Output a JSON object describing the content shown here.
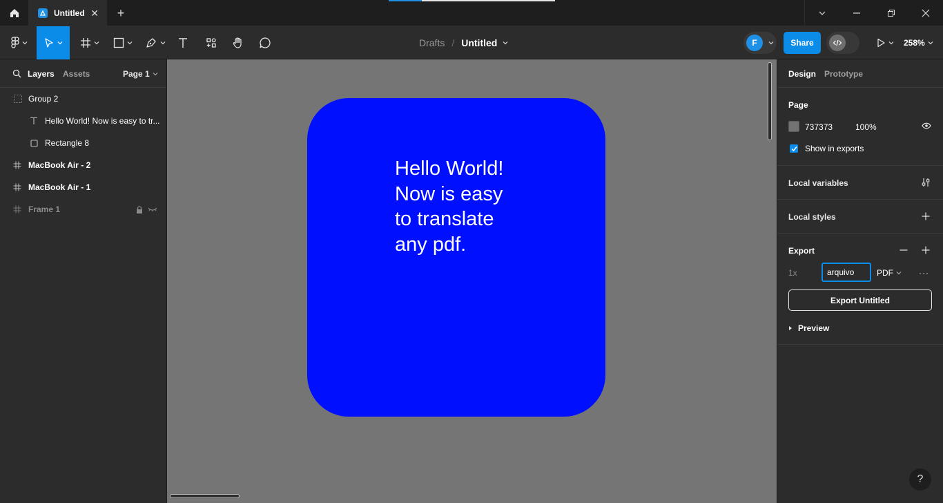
{
  "titlebar": {
    "tab_label": "Untitled",
    "tab_close": "✕",
    "new_tab": "+"
  },
  "toolbar": {
    "tools": [
      "main-menu",
      "move",
      "frame",
      "shape",
      "pen",
      "text",
      "resources",
      "hand",
      "comment"
    ],
    "active_tool": "move",
    "breadcrumb_parent": "Drafts",
    "breadcrumb_sep": "/",
    "file_title": "Untitled",
    "avatar_initial": "F",
    "share_label": "Share",
    "zoom": "258%"
  },
  "left_panel": {
    "tab_layers": "Layers",
    "tab_assets": "Assets",
    "page_selector": "Page 1",
    "layers": [
      {
        "name": "Group 2",
        "type": "group"
      },
      {
        "name": "Hello World! Now is easy to tr...",
        "type": "text"
      },
      {
        "name": "Rectangle 8",
        "type": "rectangle"
      },
      {
        "name": "MacBook Air - 2",
        "type": "frame"
      },
      {
        "name": "MacBook Air - 1",
        "type": "frame"
      },
      {
        "name": "Frame 1",
        "type": "frame",
        "locked": true,
        "hidden": true
      }
    ]
  },
  "canvas": {
    "background": "#757575",
    "card_color": "#0010FF",
    "card_text_lines": [
      "Hello World!",
      "Now is easy",
      "to translate",
      "any pdf."
    ]
  },
  "right_panel": {
    "tab_design": "Design",
    "tab_prototype": "Prototype",
    "page_section": {
      "title": "Page",
      "color_hex": "737373",
      "opacity": "100%",
      "show_in_exports_label": "Show in exports",
      "show_in_exports": true
    },
    "local_variables": "Local variables",
    "local_styles": "Local styles",
    "export": {
      "title": "Export",
      "scale": "1x",
      "suffix_value": "arquivo",
      "format": "PDF",
      "more": "···",
      "button_label": "Export Untitled",
      "preview_label": "Preview"
    }
  },
  "help_label": "?"
}
